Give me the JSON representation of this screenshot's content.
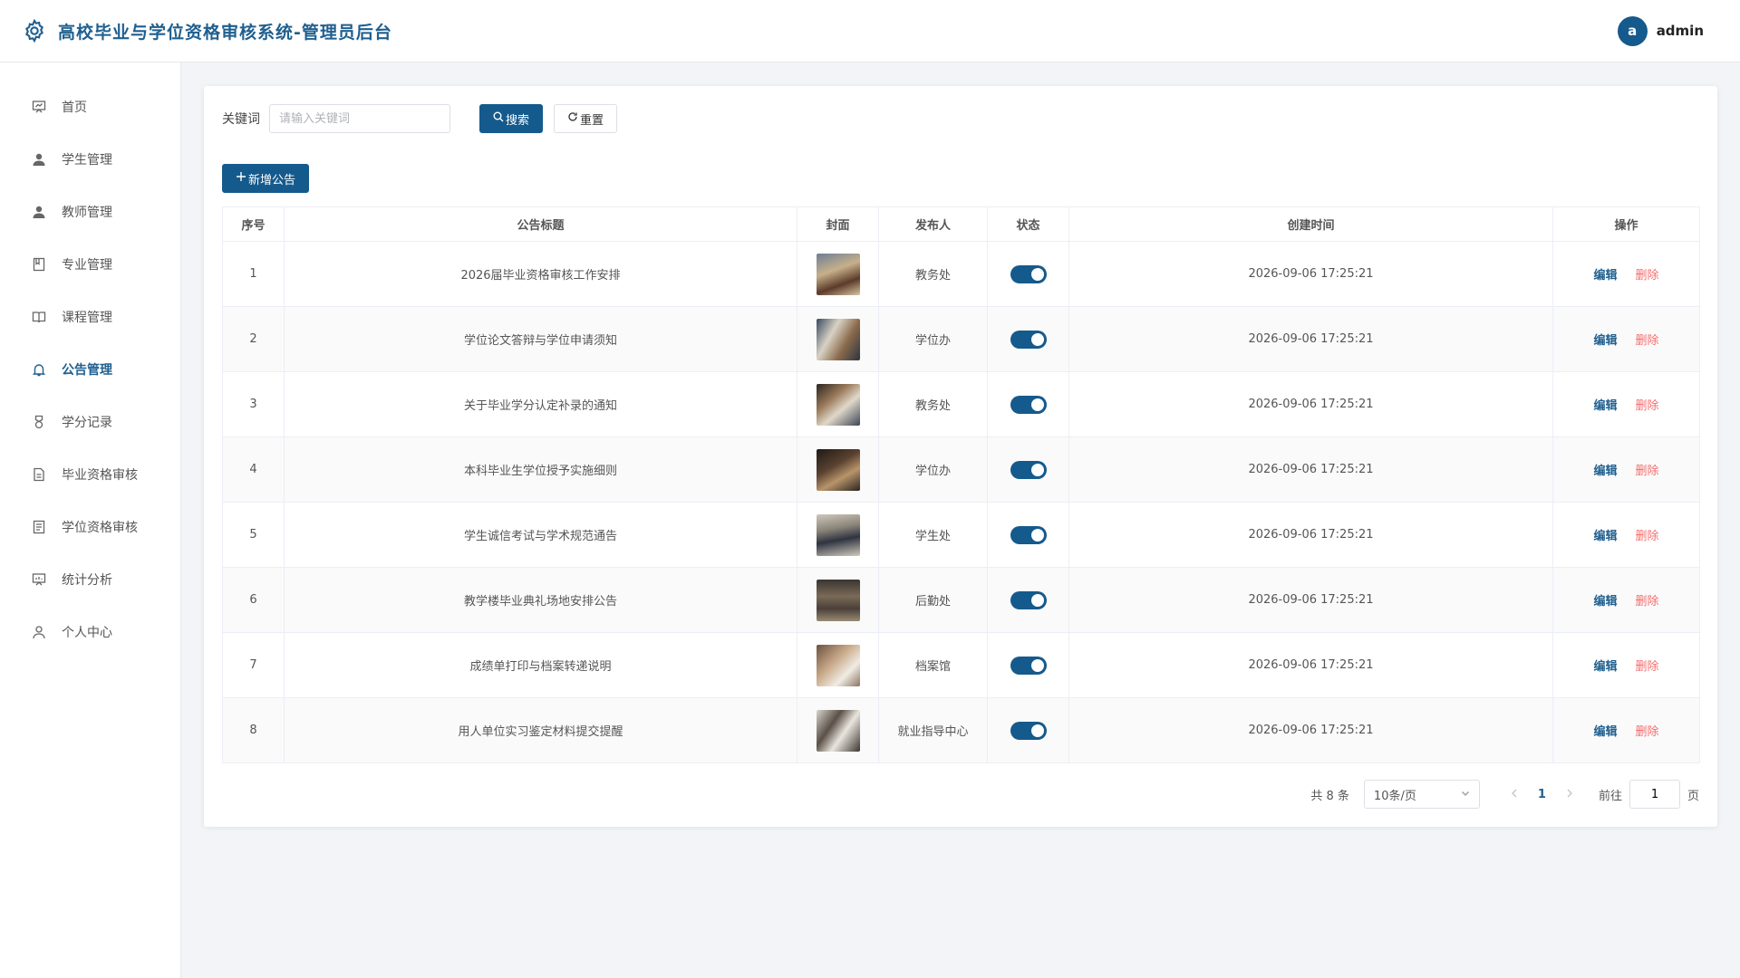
{
  "header": {
    "title": "高校毕业与学位资格审核系统-管理员后台",
    "avatar_letter": "a",
    "username": "admin"
  },
  "sidebar": {
    "items": [
      {
        "label": "首页",
        "icon": "dashboard-icon"
      },
      {
        "label": "学生管理",
        "icon": "user-icon"
      },
      {
        "label": "教师管理",
        "icon": "user-icon"
      },
      {
        "label": "专业管理",
        "icon": "notebook-icon"
      },
      {
        "label": "课程管理",
        "icon": "book-icon"
      },
      {
        "label": "公告管理",
        "icon": "bell-icon",
        "active": true
      },
      {
        "label": "学分记录",
        "icon": "medal-icon"
      },
      {
        "label": "毕业资格审核",
        "icon": "document-icon"
      },
      {
        "label": "学位资格审核",
        "icon": "document-icon"
      },
      {
        "label": "统计分析",
        "icon": "presentation-icon"
      },
      {
        "label": "个人中心",
        "icon": "person-icon"
      }
    ]
  },
  "filters": {
    "keyword_label": "关键词",
    "keyword_placeholder": "请输入关键词",
    "keyword_value": "",
    "search_label": "搜索",
    "reset_label": "重置",
    "add_label": "新增公告"
  },
  "table": {
    "headers": [
      "序号",
      "公告标题",
      "封面",
      "发布人",
      "状态",
      "创建时间",
      "操作"
    ],
    "edit_label": "编辑",
    "delete_label": "删除",
    "rows": [
      {
        "index": "1",
        "title": "2026届毕业资格审核工作安排",
        "publisher": "教务处",
        "status": true,
        "created": "2026-09-06 17:25:21"
      },
      {
        "index": "2",
        "title": "学位论文答辩与学位申请须知",
        "publisher": "学位办",
        "status": true,
        "created": "2026-09-06 17:25:21"
      },
      {
        "index": "3",
        "title": "关于毕业学分认定补录的通知",
        "publisher": "教务处",
        "status": true,
        "created": "2026-09-06 17:25:21"
      },
      {
        "index": "4",
        "title": "本科毕业生学位授予实施细则",
        "publisher": "学位办",
        "status": true,
        "created": "2026-09-06 17:25:21"
      },
      {
        "index": "5",
        "title": "学生诚信考试与学术规范通告",
        "publisher": "学生处",
        "status": true,
        "created": "2026-09-06 17:25:21"
      },
      {
        "index": "6",
        "title": "教学楼毕业典礼场地安排公告",
        "publisher": "后勤处",
        "status": true,
        "created": "2026-09-06 17:25:21"
      },
      {
        "index": "7",
        "title": "成绩单打印与档案转递说明",
        "publisher": "档案馆",
        "status": true,
        "created": "2026-09-06 17:25:21"
      },
      {
        "index": "8",
        "title": "用人单位实习鉴定材料提交提醒",
        "publisher": "就业指导中心",
        "status": true,
        "created": "2026-09-06 17:25:21"
      }
    ]
  },
  "pagination": {
    "total_text": "共 8 条",
    "page_size": "10条/页",
    "current_page": "1",
    "goto_label": "前往",
    "goto_value": "1",
    "page_suffix": "页"
  },
  "colors": {
    "primary": "#155a8c",
    "danger": "#f56c6c"
  }
}
